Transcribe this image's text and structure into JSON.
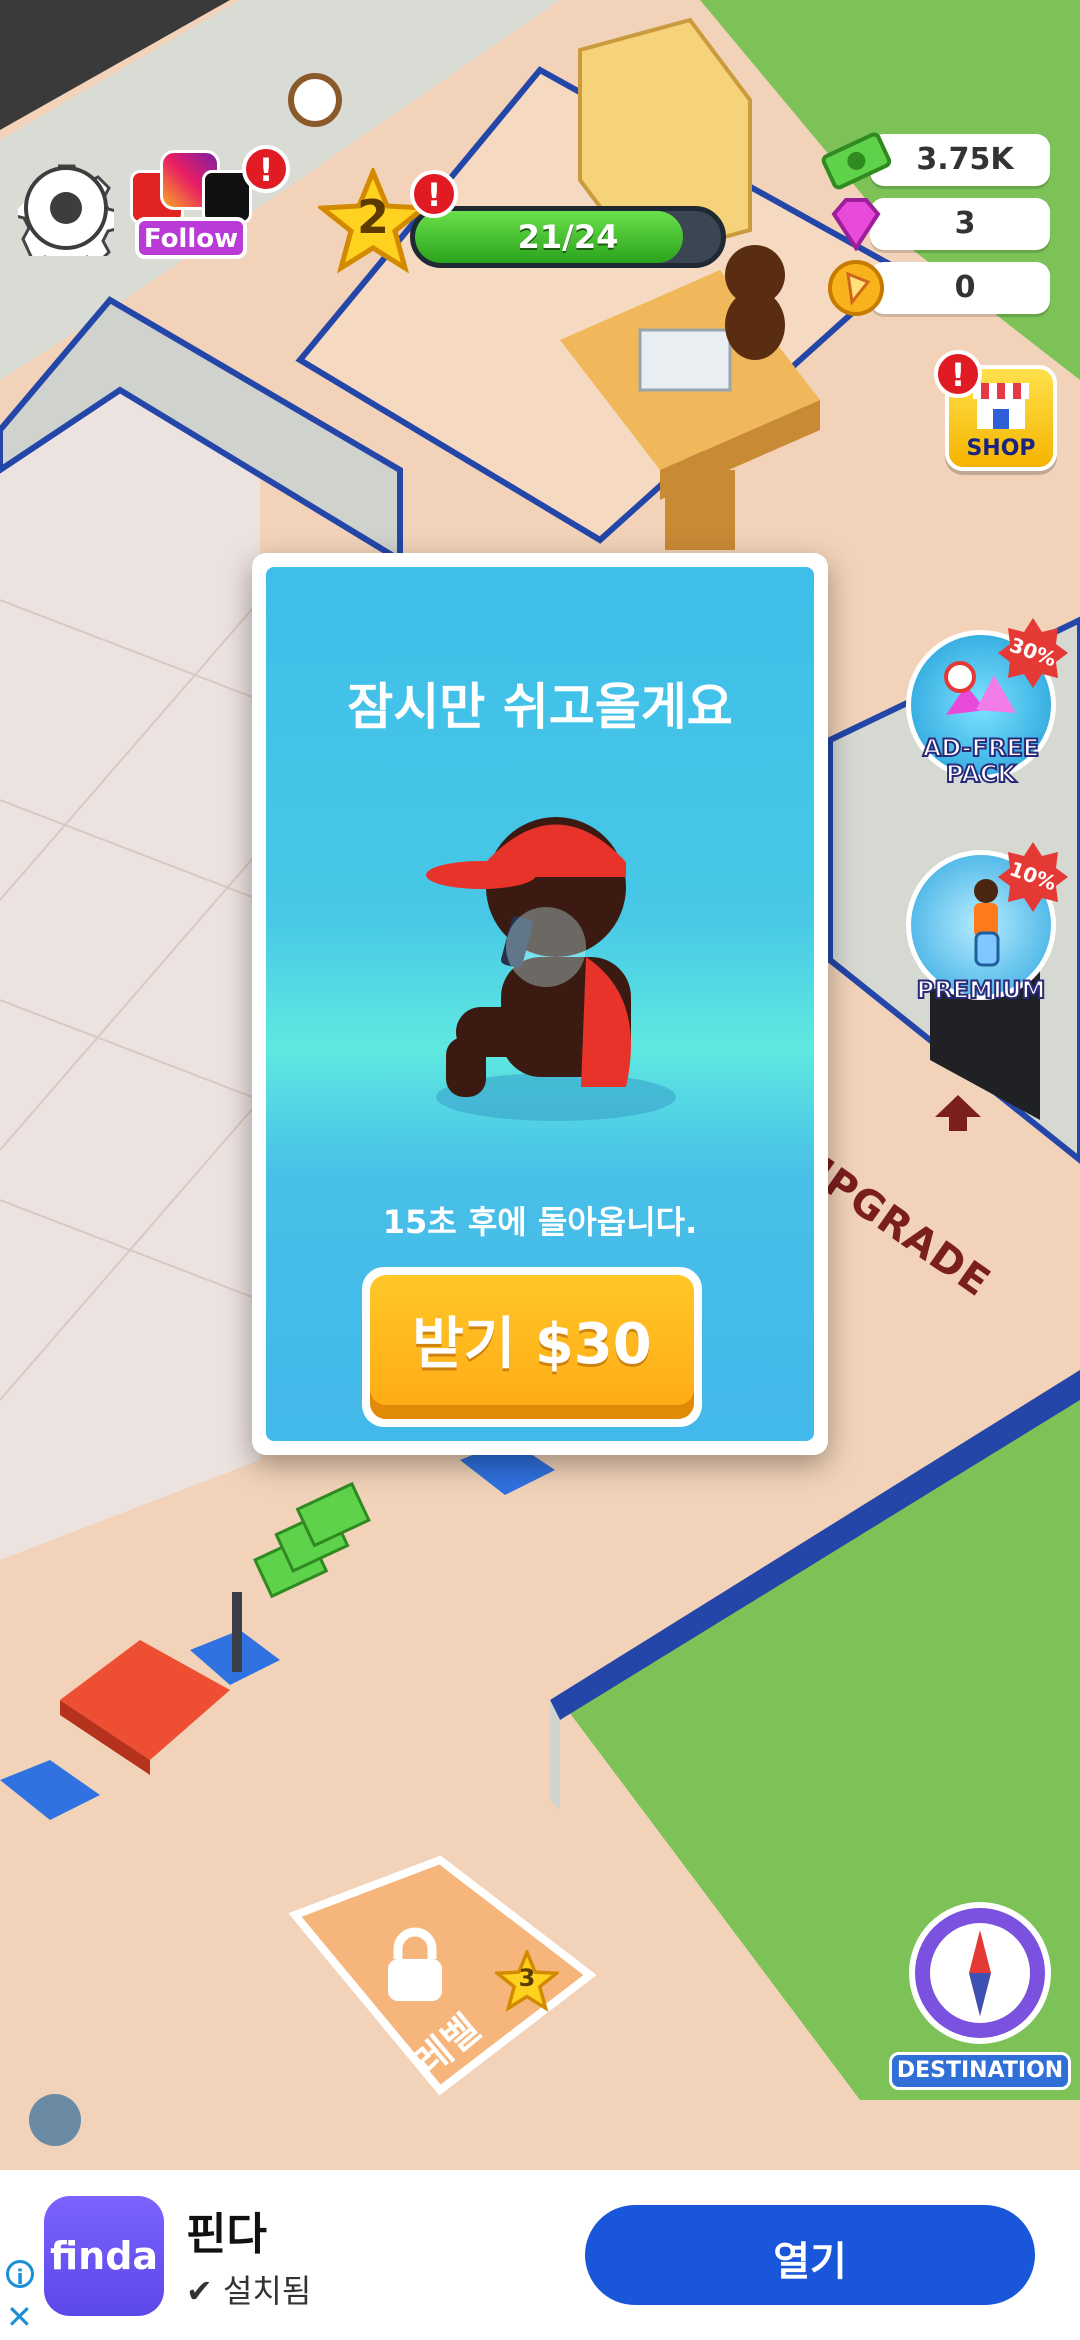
{
  "hud": {
    "follow_label": "Follow",
    "alert_mark": "!",
    "level": "2",
    "xp_text": "21/24",
    "xp_fraction": 0.875,
    "resources": [
      {
        "icon": "cash-icon",
        "value": "3.75K"
      },
      {
        "icon": "gem-icon",
        "value": "3"
      },
      {
        "icon": "pizza-coin-icon",
        "value": "0"
      }
    ],
    "shop_label": "SHOP",
    "ad_free": {
      "label_line1": "AD-FREE",
      "label_line2": "PACK",
      "discount": "30%"
    },
    "premium": {
      "label": "PREMIUM",
      "discount": "10%"
    },
    "upgrade_label": "UPGRADE",
    "destination_label": "DESTINATION",
    "floor_lock": {
      "label": "레벨",
      "level": "3"
    }
  },
  "popup": {
    "title": "잠시만 쉬고올게요",
    "subtitle": "15초 후에 돌아옵니다.",
    "claim_label": "받기 $30"
  },
  "ad": {
    "logo_text": "finda",
    "app_name": "핀다",
    "status": "설치됨",
    "open_label": "열기",
    "info_icon": "i",
    "close_icon": "✕"
  },
  "colors": {
    "popup_blue": "#43b8ea",
    "claim_orange": "#ffa914",
    "ad_button": "#1a56d9"
  }
}
